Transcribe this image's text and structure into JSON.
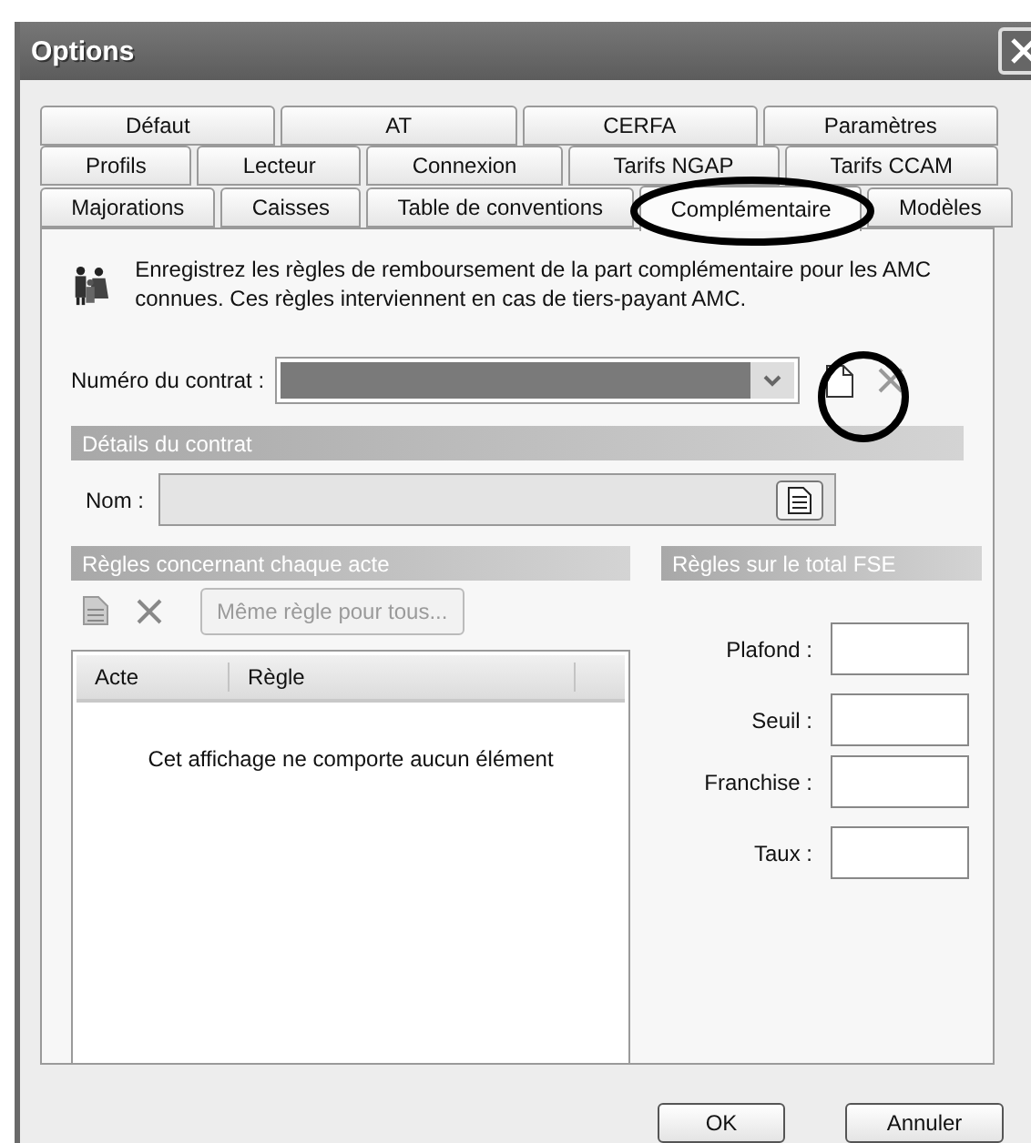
{
  "window": {
    "title": "Options"
  },
  "tab_rows": [
    [
      {
        "label": "Défaut",
        "selected": false
      },
      {
        "label": "AT",
        "selected": false
      },
      {
        "label": "CERFA",
        "selected": false
      },
      {
        "label": "Paramètres",
        "selected": false
      }
    ],
    [
      {
        "label": "Profils",
        "selected": false
      },
      {
        "label": "Lecteur",
        "selected": false
      },
      {
        "label": "Connexion",
        "selected": false
      },
      {
        "label": "Tarifs NGAP",
        "selected": false
      },
      {
        "label": "Tarifs CCAM",
        "selected": false
      }
    ],
    [
      {
        "label": "Majorations",
        "selected": false
      },
      {
        "label": "Caisses",
        "selected": false
      },
      {
        "label": "Table de conventions",
        "selected": false
      },
      {
        "label": "Complémentaire",
        "selected": true
      },
      {
        "label": "Modèles",
        "selected": false
      }
    ]
  ],
  "intro": "Enregistrez les règles de remboursement de la part complémentaire pour les AMC connues. Ces règles interviennent en cas de tiers-payant AMC.",
  "contract": {
    "label": "Numéro du contrat :"
  },
  "details": {
    "header": "Détails du contrat",
    "name_label": "Nom :"
  },
  "acts": {
    "header": "Règles concernant chaque acte",
    "same_rule_button": {
      "label": "Même règle pour tous...",
      "disabled": true
    },
    "columns": [
      "Acte",
      "Règle"
    ],
    "empty_message": "Cet affichage ne comporte aucun élément"
  },
  "totals": {
    "header": "Règles sur le total FSE",
    "fields": [
      {
        "label": "Plafond :"
      },
      {
        "label": "Seuil :"
      },
      {
        "label": "Franchise :"
      },
      {
        "label": "Taux :"
      }
    ]
  },
  "buttons": [
    "OK",
    "Annuler"
  ]
}
